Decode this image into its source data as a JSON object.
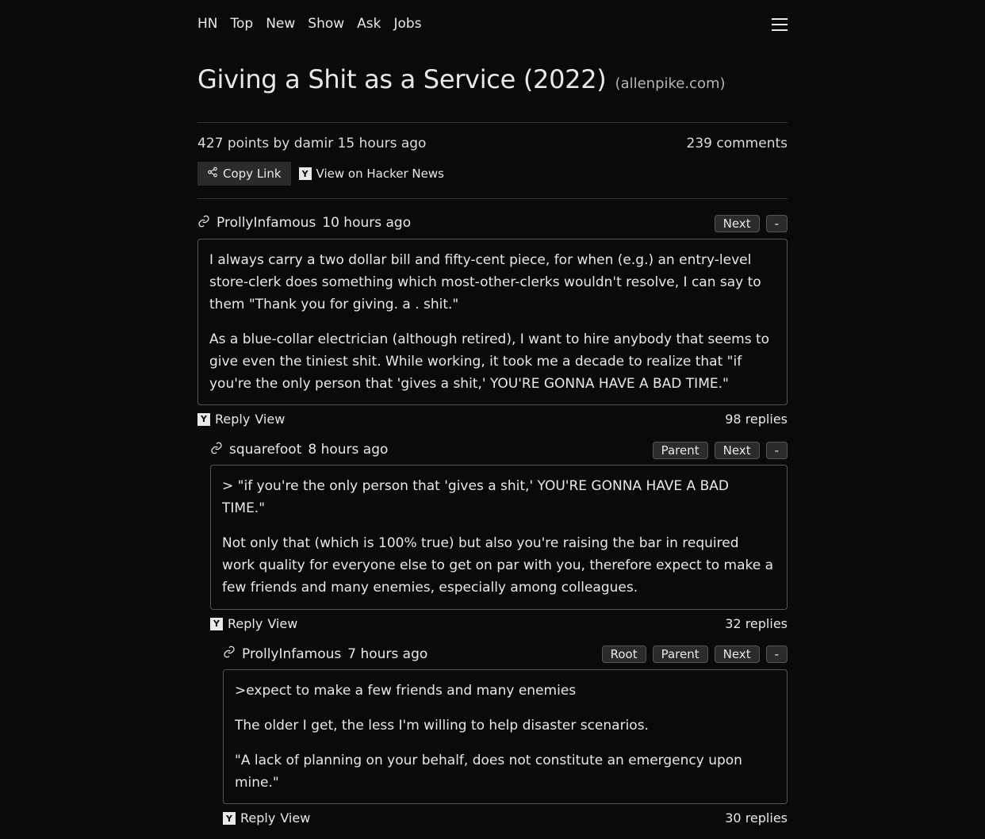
{
  "nav": {
    "items": [
      "HN",
      "Top",
      "New",
      "Show",
      "Ask",
      "Jobs"
    ]
  },
  "post": {
    "title": "Giving a Shit as a Service (2022)",
    "domain": "(allenpike.com)",
    "meta": "427 points by damir 15 hours ago",
    "comments_label": "239 comments",
    "copy_link": "Copy Link",
    "view_hn": "View on Hacker News"
  },
  "labels": {
    "reply": "Reply",
    "view": "View",
    "next": "Next",
    "parent": "Parent",
    "root": "Root",
    "collapse": "-"
  },
  "comments": [
    {
      "author": "ProllyInfamous",
      "age": "10 hours ago",
      "nav_buttons": [
        "next",
        "collapse"
      ],
      "indent": 0,
      "paragraphs": [
        "I always carry a two dollar bill and fifty-cent piece, for when (e.g.) an entry-level store-clerk does something which most-other-clerks wouldn't resolve, I can say to them \"Thank you for giving. a . shit.\"",
        "As a blue-collar electrician (although retired), I want to hire anybody that seems to give even the tiniest shit. While working, it took me a decade to realize that \"if you're the only person that 'gives a shit,' YOU'RE GONNA HAVE A BAD TIME.\""
      ],
      "replies": "98 replies"
    },
    {
      "author": "squarefoot",
      "age": "8 hours ago",
      "nav_buttons": [
        "parent",
        "next",
        "collapse"
      ],
      "indent": 1,
      "paragraphs": [
        "> \"if you're the only person that 'gives a shit,' YOU'RE GONNA HAVE A BAD TIME.\"",
        "Not only that (which is 100% true) but also you're raising the bar in required work quality for everyone else to get on par with you, therefore expect to make a few friends and many enemies, especially among colleagues."
      ],
      "replies": "32 replies"
    },
    {
      "author": "ProllyInfamous",
      "age": "7 hours ago",
      "nav_buttons": [
        "root",
        "parent",
        "next",
        "collapse"
      ],
      "indent": 2,
      "paragraphs": [
        ">expect to make a few friends and many enemies",
        "The older I get, the less I'm willing to help disaster scenarios.",
        "\"A lack of planning on your behalf, does not constitute an emergency upon mine.\""
      ],
      "replies": "30 replies"
    }
  ]
}
